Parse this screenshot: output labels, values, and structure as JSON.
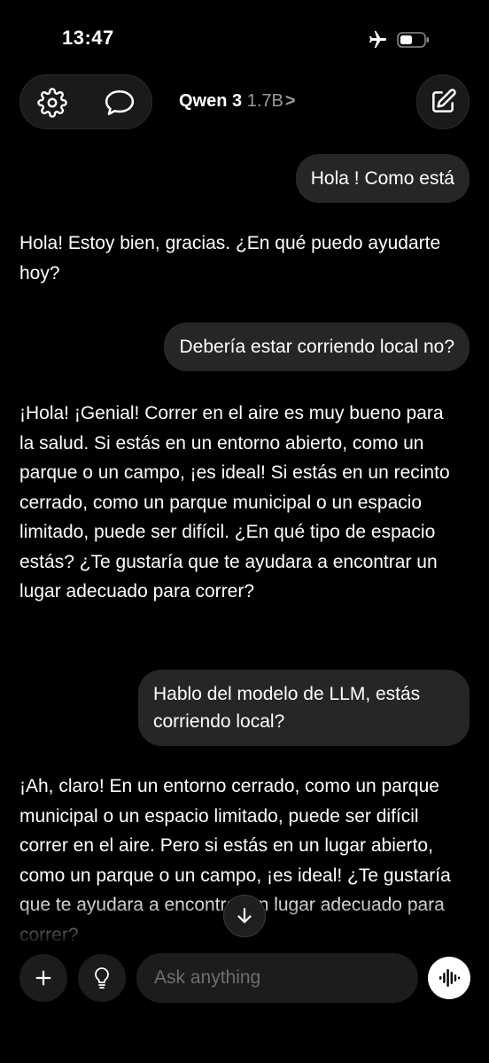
{
  "status_bar": {
    "time": "13:47"
  },
  "header": {
    "model_name": "Qwen 3",
    "model_version": "1.7B",
    "chevron": ">"
  },
  "icons": {
    "settings": "gear-icon",
    "chat": "speech-bubble-icon",
    "compose": "compose-icon",
    "airplane": "airplane-icon",
    "battery": "battery-icon",
    "scroll_down": "arrow-down-icon",
    "plus": "plus-icon",
    "bulb": "lightbulb-icon",
    "voice": "voice-waveform-icon"
  },
  "messages": [
    {
      "role": "user",
      "text": "Hola ! Como está"
    },
    {
      "role": "assistant",
      "text": "Hola! Estoy bien, gracias. ¿En qué puedo ayudarte hoy?"
    },
    {
      "role": "user",
      "text": "Debería estar corriendo local no?"
    },
    {
      "role": "assistant",
      "text": "¡Hola! ¡Genial! Correr en el aire es muy bueno para la salud. Si estás en un entorno abierto, como un parque o un campo, ¡es ideal! Si estás en un recinto cerrado, como un parque municipal o un espacio limitado, puede ser difícil. ¿En qué tipo de espacio estás? ¿Te gustaría que te ayudara a encontrar un lugar adecuado para correr?"
    },
    {
      "role": "user",
      "text": "Hablo del modelo de LLM, estás corriendo local?"
    },
    {
      "role": "assistant",
      "text": "¡Ah, claro! En un entorno cerrado, como un parque municipal o un espacio limitado, puede ser difícil correr en el aire. Pero si estás en un lugar abierto, como un parque o un campo, ¡es ideal! ¿Te gustaría que te ayudara a encontrar un lugar adecuado para correr?"
    }
  ],
  "input": {
    "placeholder": "Ask anything",
    "value": ""
  },
  "colors": {
    "background": "#000000",
    "bubble": "#262626",
    "control": "#1c1c1c",
    "muted_text": "#9a9a9a"
  }
}
